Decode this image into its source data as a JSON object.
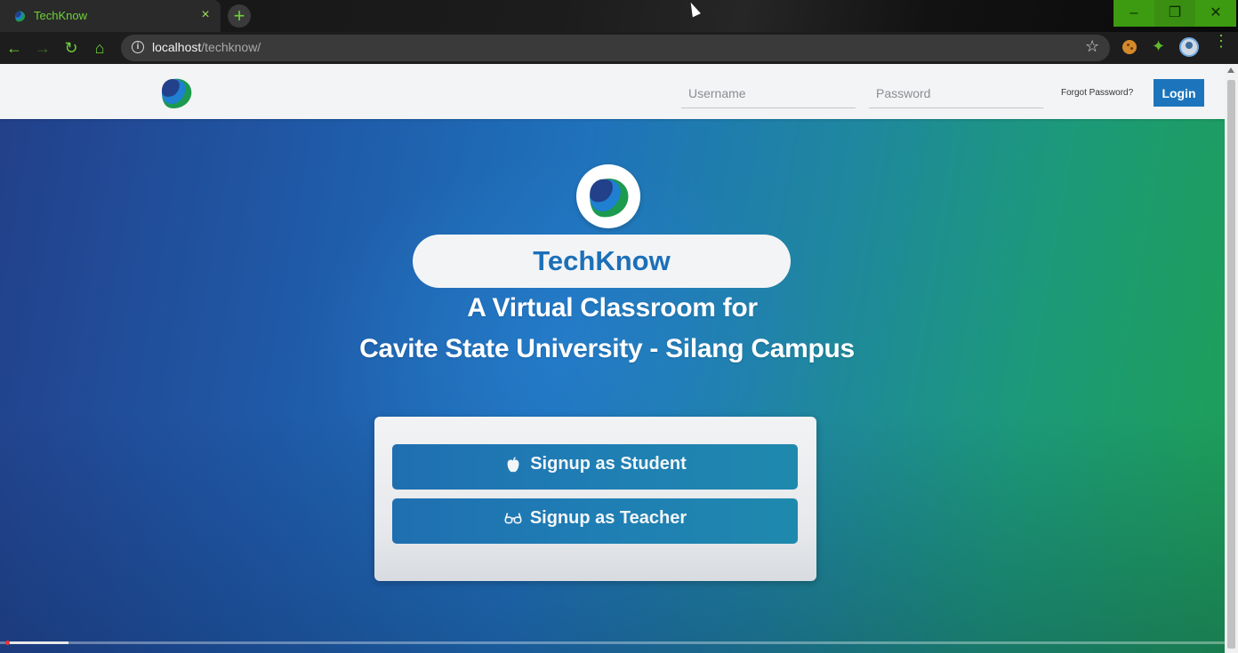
{
  "browser": {
    "tab": {
      "title": "TechKnow",
      "close": "×",
      "favicon": "techknow-logo-icon"
    },
    "new_tab": "+",
    "window_controls": {
      "minimize": "–",
      "restore": "❐",
      "close": "✕"
    },
    "nav": {
      "back": "←",
      "forward": "→",
      "reload": "↻",
      "home": "⌂"
    },
    "address": {
      "host": "localhost",
      "path": "/techknow/"
    },
    "icons": [
      "info-icon",
      "star-icon",
      "cookie-extension-icon",
      "puzzle-extension-icon",
      "profile-avatar-icon",
      "menu-icon"
    ],
    "accent_color": "#6fd23a"
  },
  "header": {
    "username_placeholder": "Username",
    "password_placeholder": "Password",
    "forgot_label": "Forgot Password?",
    "login_label": "Login",
    "login_color": "#1c75bc"
  },
  "hero": {
    "brand": "TechKnow",
    "tagline_line1": "A Virtual Classroom for",
    "tagline_line2": "Cavite State University - Silang Campus",
    "gradient": [
      "#23408a",
      "#1f72bb",
      "#1e9f55"
    ]
  },
  "signup": {
    "student_label": "Signup as Student",
    "student_icon": "apple-icon",
    "teacher_label": "Signup as Teacher",
    "teacher_icon": "glasses-icon"
  },
  "video": {
    "progress_fraction": 0.05
  }
}
